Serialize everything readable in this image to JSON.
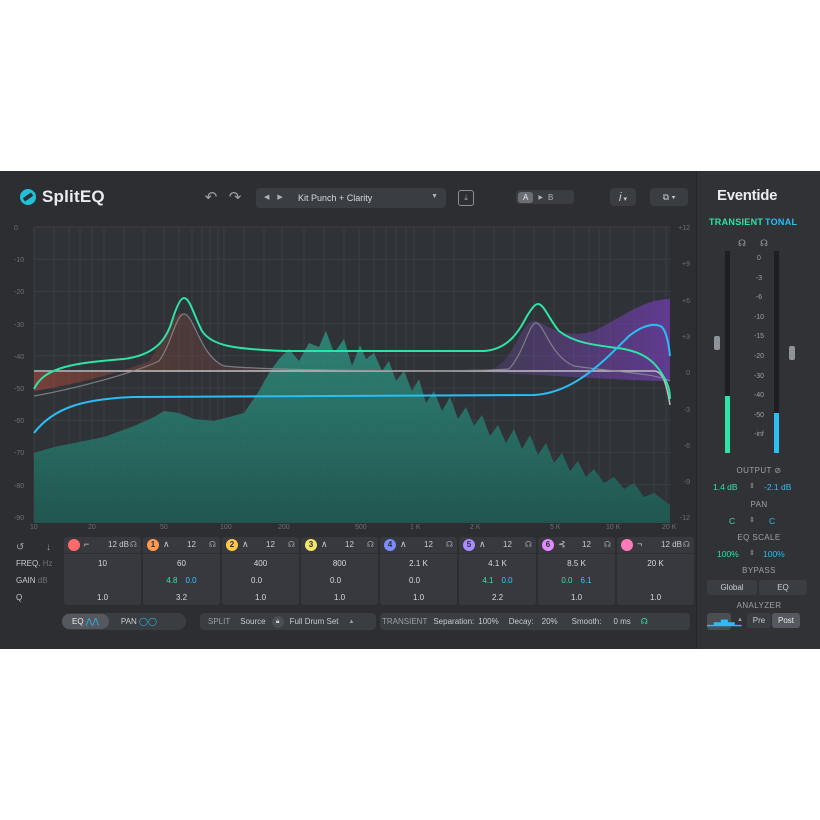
{
  "header": {
    "app_name": "SplitEQ",
    "undo_glyph": "↶",
    "redo_glyph": "↷",
    "preset_name": "Kit Punch + Clarity",
    "ab_a": "A",
    "ab_b": "B",
    "info_glyph": "i",
    "share_glyph": "⧉ ▾"
  },
  "graph": {
    "y_left_labels": [
      "0",
      "-10",
      "-20",
      "-30",
      "-40",
      "-50",
      "-60",
      "-70",
      "-80",
      "-90"
    ],
    "y_right_labels": [
      "+12",
      "+9",
      "+6",
      "+3",
      "0",
      "-3",
      "-6",
      "-9",
      "-12"
    ],
    "x_labels": [
      "10",
      "20",
      "50",
      "100",
      "200",
      "500",
      "1 K",
      "2 K",
      "5 K",
      "10 K",
      "20 K"
    ]
  },
  "band_rows": {
    "freq": "FREQ.",
    "freq_unit": "Hz",
    "gain": "GAIN",
    "gain_unit": "dB",
    "q": "Q"
  },
  "bands": [
    {
      "num": "",
      "color": "#ff6b6b",
      "shape": "⌐",
      "db": "12 dB",
      "freq": "10",
      "gain_a": "",
      "gain_b": "",
      "q": "1.0"
    },
    {
      "num": "1",
      "color": "#ff9a52",
      "shape": "∧",
      "db": "12",
      "freq": "60",
      "gain_a": "4.8",
      "gain_b": "0.0",
      "q": "3.2"
    },
    {
      "num": "2",
      "color": "#ffc84a",
      "shape": "∧",
      "db": "12",
      "freq": "400",
      "gain_a": "0.0",
      "gain_b": "",
      "q": "1.0"
    },
    {
      "num": "3",
      "color": "#f3e66a",
      "shape": "∧",
      "db": "12",
      "freq": "800",
      "gain_a": "0.0",
      "gain_b": "",
      "q": "1.0"
    },
    {
      "num": "4",
      "color": "#7a8cff",
      "shape": "∧",
      "db": "12",
      "freq": "2.1 K",
      "gain_a": "0.0",
      "gain_b": "",
      "q": "1.0"
    },
    {
      "num": "5",
      "color": "#a98cff",
      "shape": "∧",
      "db": "12",
      "freq": "4.1 K",
      "gain_a": "4.1",
      "gain_b": "0.0",
      "q": "2.2"
    },
    {
      "num": "6",
      "color": "#e08cff",
      "shape": "⊰",
      "db": "12",
      "freq": "8.5 K",
      "gain_a": "0.0",
      "gain_b": "6.1",
      "q": "1.0"
    },
    {
      "num": "",
      "color": "#ff7ab8",
      "shape": "¬",
      "db": "12 dB",
      "freq": "20 K",
      "gain_a": "",
      "gain_b": "",
      "q": "1.0"
    }
  ],
  "footer": {
    "eq": "EQ",
    "pan": "PAN",
    "split": "SPLIT",
    "source_label": "Source",
    "source_value": "Full Drum Set",
    "transient": "TRANSIENT",
    "separation_label": "Separation:",
    "separation_value": "100%",
    "decay_label": "Decay:",
    "decay_value": "20%",
    "smooth_label": "Smooth:",
    "smooth_value": "0 ms"
  },
  "side": {
    "brand": "Eventide",
    "transient": "TRANSIENT",
    "tonal": "TONAL",
    "meter_scale": [
      "0",
      "-3",
      "-6",
      "-10",
      "-15",
      "-20",
      "-30",
      "-40",
      "-50",
      "-inf"
    ],
    "meter_levels": {
      "transient": 0.28,
      "tonal": 0.2
    },
    "output": "OUTPUT",
    "output_transient": "1.4 dB",
    "output_tonal": "-2.1 dB",
    "pan": "PAN",
    "pan_transient": "C",
    "pan_tonal": "C",
    "eq_scale": "EQ SCALE",
    "eq_scale_transient": "100%",
    "eq_scale_tonal": "100%",
    "bypass": "BYPASS",
    "bypass_global": "Global",
    "bypass_eq": "EQ",
    "analyzer": "ANALYZER",
    "analyzer_pre": "Pre",
    "analyzer_post": "Post"
  },
  "colors": {
    "transient": "#2fe3a6",
    "tonal": "#2bbdf5",
    "background": "#2c2e32"
  }
}
